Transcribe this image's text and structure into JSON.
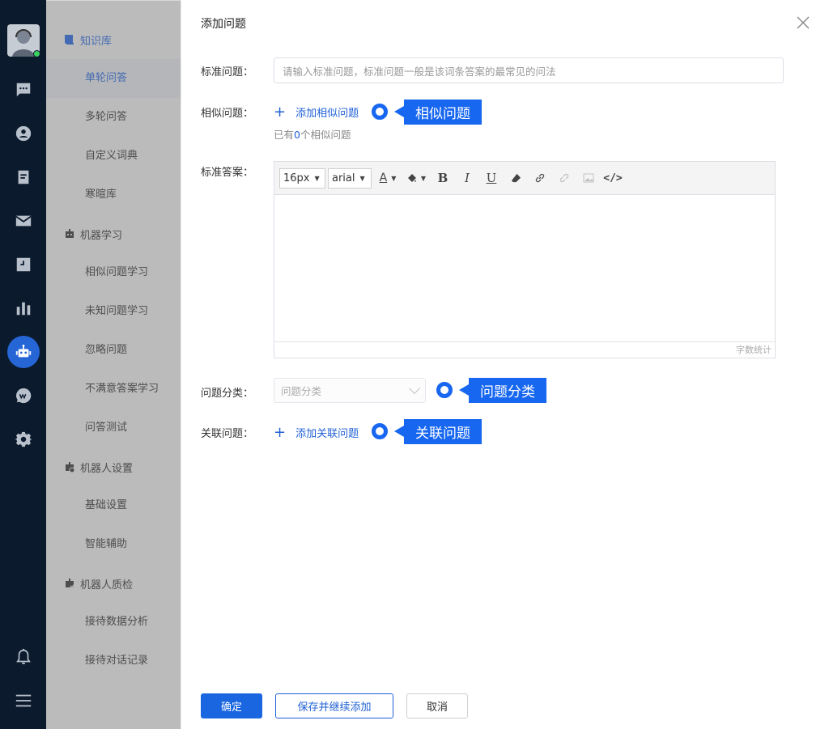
{
  "nav": {
    "groups": [
      {
        "label": "知识库",
        "items": [
          "单轮问答",
          "多轮问答",
          "自定义词典",
          "寒暄库"
        ]
      },
      {
        "label": "机器学习",
        "items": [
          "相似问题学习",
          "未知问题学习",
          "忽略问题",
          "不满意答案学习",
          "问答测试"
        ]
      },
      {
        "label": "机器人设置",
        "items": [
          "基础设置",
          "智能辅助"
        ]
      },
      {
        "label": "机器人质检",
        "items": [
          "接待数据分析",
          "接待对话记录"
        ]
      }
    ],
    "active_item": "单轮问答"
  },
  "rail_icons": [
    "chat-icon",
    "contact-icon",
    "clipboard-icon",
    "mail-icon",
    "clock-icon",
    "chart-icon",
    "robot-icon",
    "wechat-icon",
    "settings-icon",
    "bell-icon",
    "menu-icon"
  ],
  "dialog": {
    "title": "添加问题",
    "standard_question": {
      "label": "标准问题：",
      "placeholder": "请输入标准问题，标准问题一般是该词条答案的最常见的问法"
    },
    "similar_question": {
      "label": "相似问题：",
      "add_link": "添加相似问题",
      "hint_prefix": "已有",
      "hint_count": "0",
      "hint_suffix": "个相似问题",
      "callout": "相似问题"
    },
    "standard_answer": {
      "label": "标准答案：",
      "font_size": "16px",
      "font_family": "arial",
      "word_count": "字数统计"
    },
    "category": {
      "label": "问题分类：",
      "placeholder": "问题分类",
      "callout": "问题分类"
    },
    "related": {
      "label": "关联问题：",
      "add_link": "添加关联问题",
      "callout": "关联问题"
    },
    "buttons": {
      "confirm": "确定",
      "save_continue": "保存并继续添加",
      "cancel": "取消"
    }
  },
  "colors": {
    "accent": "#1867f0",
    "rail_bg": "#0b1a2c",
    "link": "#2262d6"
  }
}
